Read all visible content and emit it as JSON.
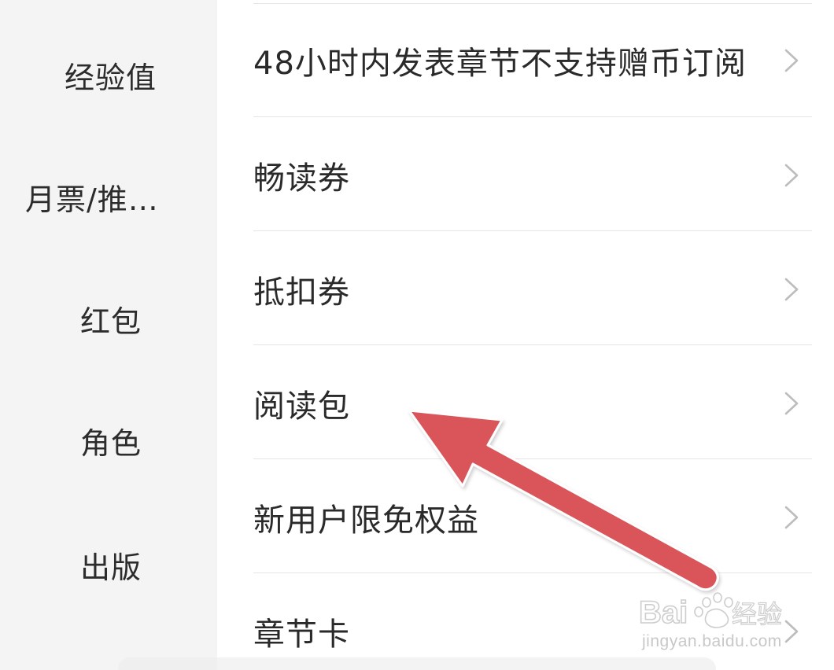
{
  "sidebar": {
    "items": [
      {
        "label": "经验值"
      },
      {
        "label": "月票/推…"
      },
      {
        "label": "红包"
      },
      {
        "label": "角色"
      },
      {
        "label": "出版"
      }
    ]
  },
  "list": {
    "rows": [
      {
        "label": "48小时内发表章节不支持赠币订阅"
      },
      {
        "label": "畅读券"
      },
      {
        "label": "抵扣券"
      },
      {
        "label": "阅读包"
      },
      {
        "label": "新用户限免权益"
      },
      {
        "label": "章节卡"
      }
    ]
  },
  "annotation": {
    "arrow_color": "#d9545a"
  },
  "watermark": {
    "logo_text": "Bai du 经验",
    "url": "jingyan.baidu.com"
  }
}
